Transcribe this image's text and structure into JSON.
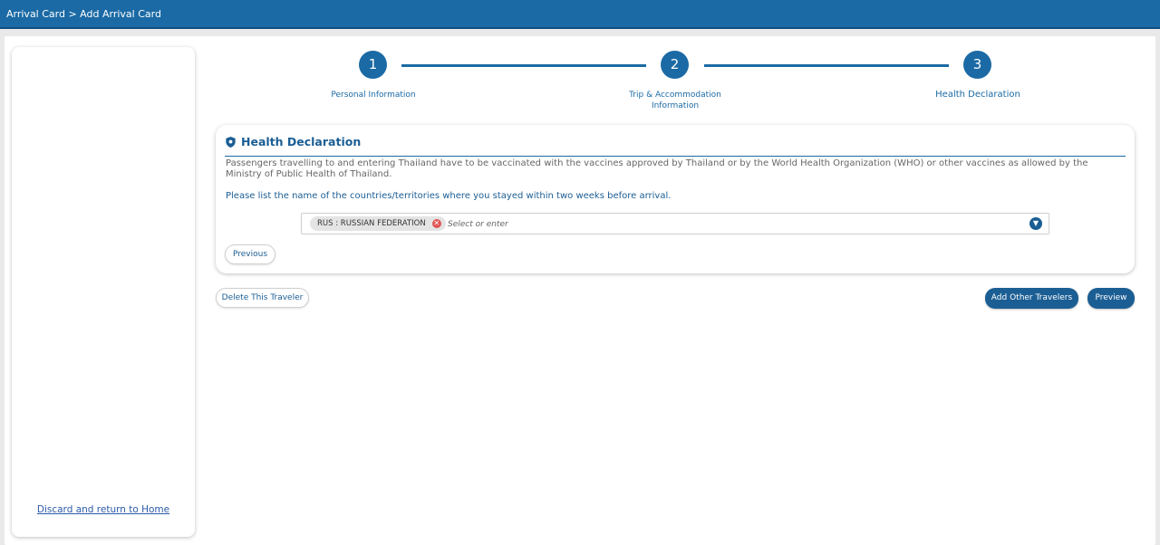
{
  "topbar": {
    "breadcrumb": "Arrival Card > Add Arrival Card"
  },
  "sidebar": {
    "discard_link": "Discard and return to Home"
  },
  "stepper": {
    "steps": [
      {
        "number": "1",
        "label": "Personal Information"
      },
      {
        "number": "2",
        "label": "Trip & Accommodation Information"
      },
      {
        "number": "3",
        "label": "Health Declaration"
      }
    ],
    "active_step": 3
  },
  "health": {
    "title": "Health Declaration",
    "icon": "shield-icon",
    "description": "Passengers travelling to and entering Thailand have to be vaccinated with the vaccines approved by Thailand or by the World Health Organization (WHO) or other vaccines as allowed by the Ministry of Public Health of Thailand.",
    "question": "Please list the name of the countries/territories where you stayed within two weeks before arrival.",
    "selected_countries": [
      "RUS : RUSSIAN FEDERATION"
    ],
    "select_placeholder": "Select or enter",
    "previous_button": "Previous"
  },
  "actions": {
    "delete_traveler": "Delete This Traveler",
    "add_other_travelers": "Add Other Travelers",
    "preview": "Preview"
  },
  "colors": {
    "brand": "#1b6aa5",
    "remove_tag": "#e05555"
  }
}
